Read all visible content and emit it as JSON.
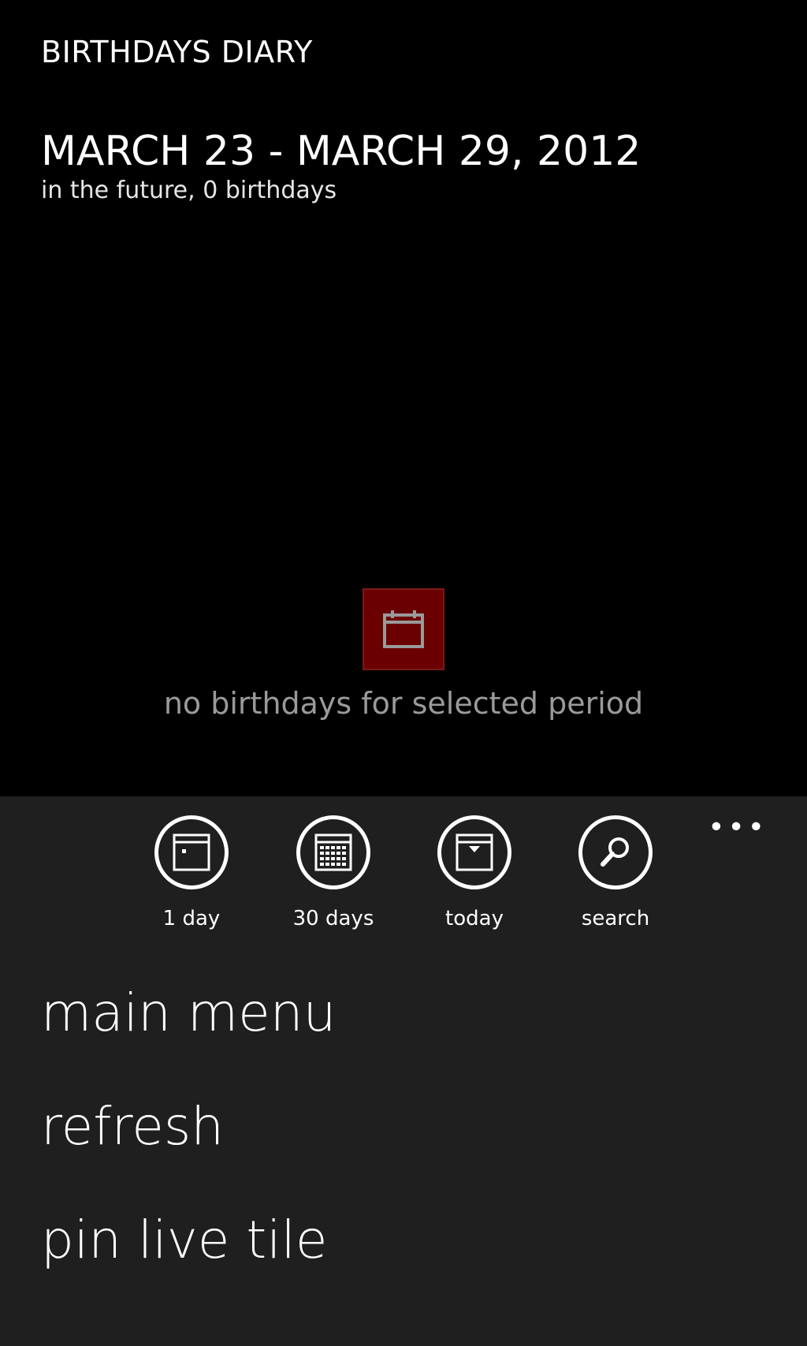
{
  "header": {
    "app_title": "BIRTHDAYS DIARY",
    "period_title": "MARCH 23 - MARCH 29, 2012",
    "period_subtitle": "in the future, 0 birthdays"
  },
  "empty_state": {
    "icon": "calendar-icon",
    "message": "no birthdays for selected period",
    "tile_color": "#6b0000"
  },
  "app_bar": {
    "more": "•••",
    "buttons": [
      {
        "icon": "one-day-calendar-icon",
        "label": "1 day"
      },
      {
        "icon": "month-calendar-icon",
        "label": "30 days"
      },
      {
        "icon": "today-calendar-icon",
        "label": "today"
      },
      {
        "icon": "search-icon",
        "label": "search"
      }
    ],
    "menu_items": [
      "main menu",
      "refresh",
      "pin live tile"
    ],
    "background": "#1f1f1f"
  }
}
